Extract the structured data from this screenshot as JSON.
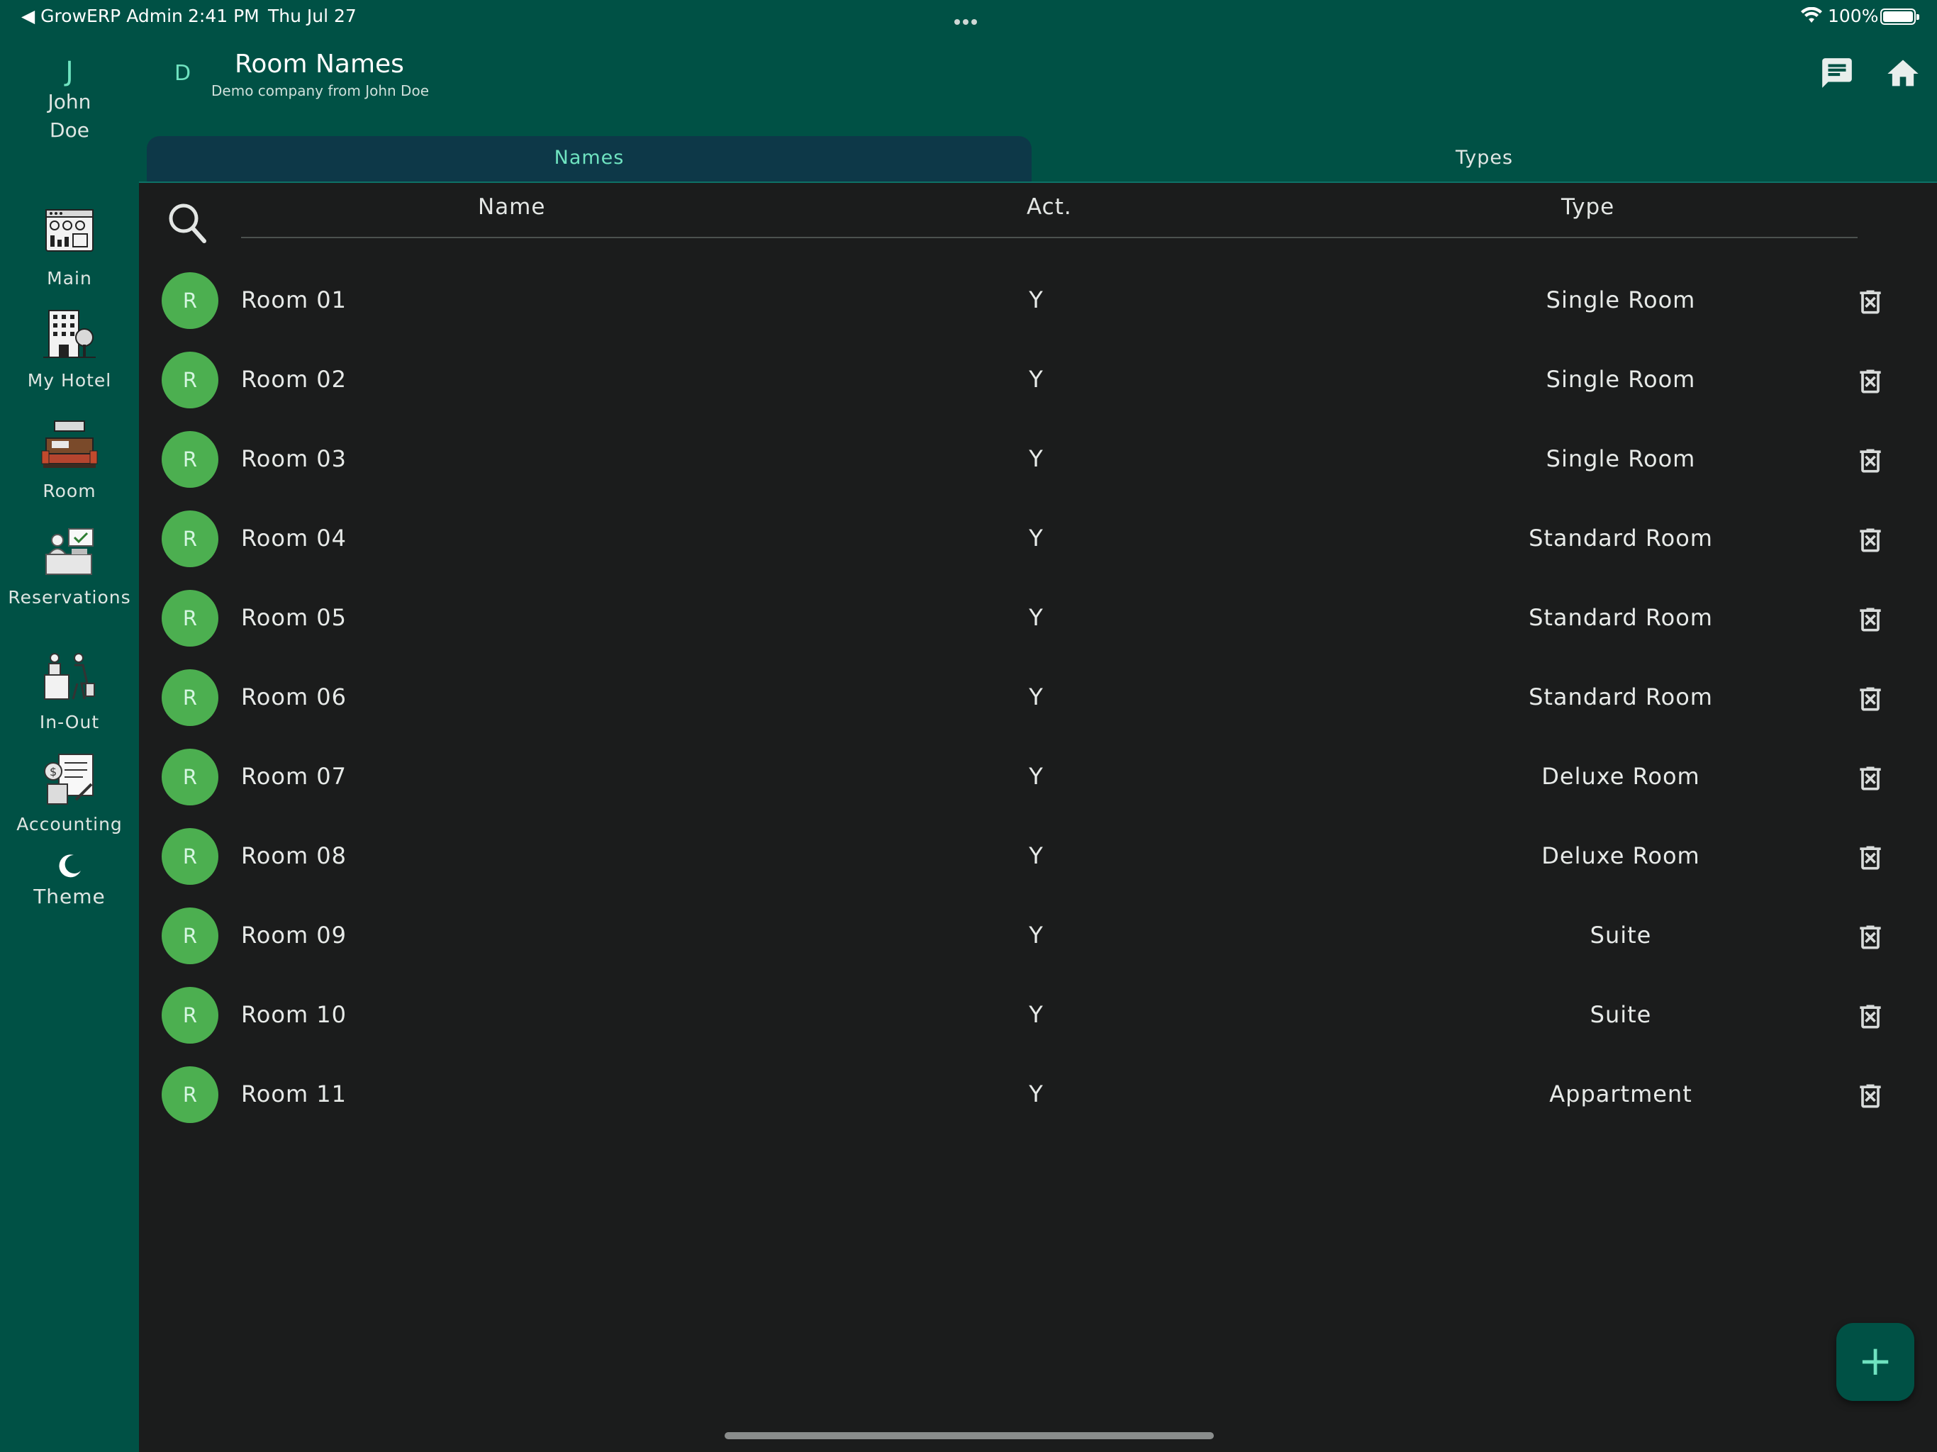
{
  "status_bar": {
    "back_label": "◀ GrowERP Admin",
    "time": "2:41 PM",
    "date": "Thu Jul 27",
    "battery": "100%"
  },
  "user": {
    "initial": "J",
    "name": "John Doe"
  },
  "nav": [
    {
      "label": "Main",
      "icon": "dashboard-icon"
    },
    {
      "label": "My Hotel",
      "icon": "hotel-building-icon"
    },
    {
      "label": "Room",
      "icon": "hotel-room-bed-icon"
    },
    {
      "label": "Reservations",
      "icon": "reservations-desk-icon"
    },
    {
      "label": "In-Out",
      "icon": "checkin-checkout-icon"
    },
    {
      "label": "Accounting",
      "icon": "accounting-icon"
    },
    {
      "label": "Theme",
      "icon": "moon-icon"
    }
  ],
  "header": {
    "company_initial": "D",
    "title": "Room Names",
    "subtitle": "Demo company from John Doe"
  },
  "tabs": [
    {
      "label": "Names",
      "active": true
    },
    {
      "label": "Types",
      "active": false
    }
  ],
  "table": {
    "columns": {
      "name": "Name",
      "act": "Act.",
      "type": "Type"
    },
    "rows": [
      {
        "avatar": "R",
        "name": "Room 01",
        "act": "Y",
        "type": "Single Room"
      },
      {
        "avatar": "R",
        "name": "Room 02",
        "act": "Y",
        "type": "Single Room"
      },
      {
        "avatar": "R",
        "name": "Room 03",
        "act": "Y",
        "type": "Single Room"
      },
      {
        "avatar": "R",
        "name": "Room 04",
        "act": "Y",
        "type": "Standard Room"
      },
      {
        "avatar": "R",
        "name": "Room 05",
        "act": "Y",
        "type": "Standard Room"
      },
      {
        "avatar": "R",
        "name": "Room 06",
        "act": "Y",
        "type": "Standard Room"
      },
      {
        "avatar": "R",
        "name": "Room 07",
        "act": "Y",
        "type": "Deluxe Room"
      },
      {
        "avatar": "R",
        "name": "Room 08",
        "act": "Y",
        "type": "Deluxe Room"
      },
      {
        "avatar": "R",
        "name": "Room 09",
        "act": "Y",
        "type": "Suite"
      },
      {
        "avatar": "R",
        "name": "Room 10",
        "act": "Y",
        "type": "Suite"
      },
      {
        "avatar": "R",
        "name": "Room 11",
        "act": "Y",
        "type": "Appartment"
      }
    ]
  },
  "fab": {
    "label": "+"
  },
  "colors": {
    "primary": "#005145",
    "accent": "#6fe3c0",
    "background": "#1b1c1c",
    "avatar": "#4caf50",
    "active_tab": "#0d3848"
  }
}
